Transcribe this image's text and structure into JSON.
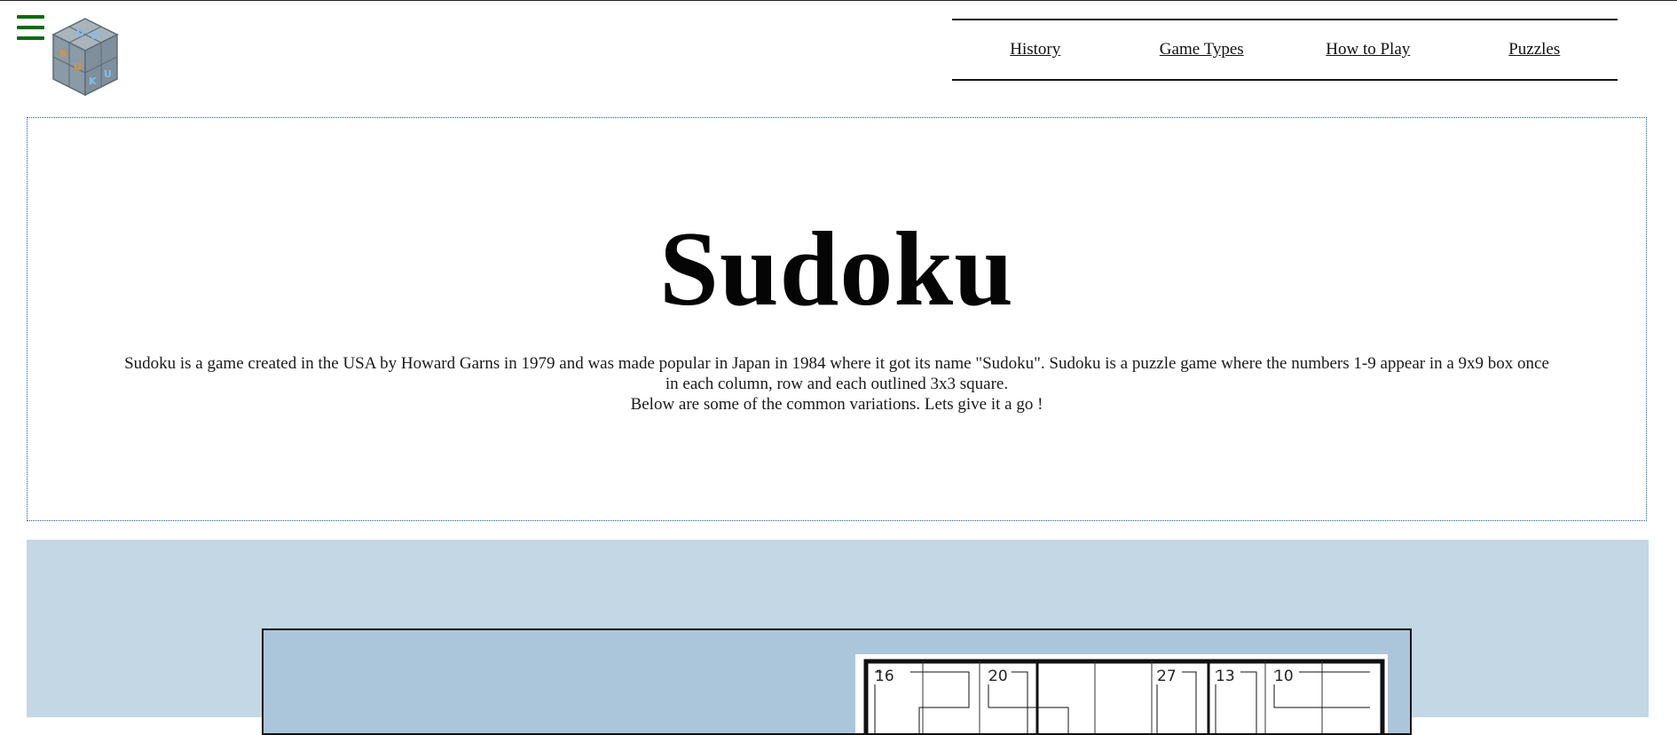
{
  "header": {
    "menu_icon": "hamburger-menu-icon",
    "logo_letters": [
      "S",
      "U",
      "D",
      "O",
      "K",
      "U"
    ],
    "nav": [
      {
        "label": "History"
      },
      {
        "label": "Game Types"
      },
      {
        "label": "How to Play"
      },
      {
        "label": "Puzzles"
      }
    ]
  },
  "hero": {
    "title": "Sudoku",
    "intro_line1": "Sudoku is a game created in the USA by Howard Garns in 1979 and was made popular in Japan in 1984 where it got its name \"Sudoku\". Sudoku is a puzzle game where the numbers 1-9 appear in a 9x9 box once in each column, row and each outlined 3x3 square.",
    "intro_line2": "Below are some of the common variations. Lets give it a go !"
  },
  "killer_puzzle": {
    "cage_sums": [
      "16",
      "20",
      "27",
      "13",
      "10"
    ]
  },
  "colors": {
    "menu_icon": "#0a6a12",
    "hero_border": "#1a5fa8",
    "section_bg": "#c4d7e5",
    "card_bg": "#abc5da",
    "logo_cube": "#8a9aa6",
    "logo_orange": "#f09020",
    "logo_blue": "#7ec0ec"
  }
}
